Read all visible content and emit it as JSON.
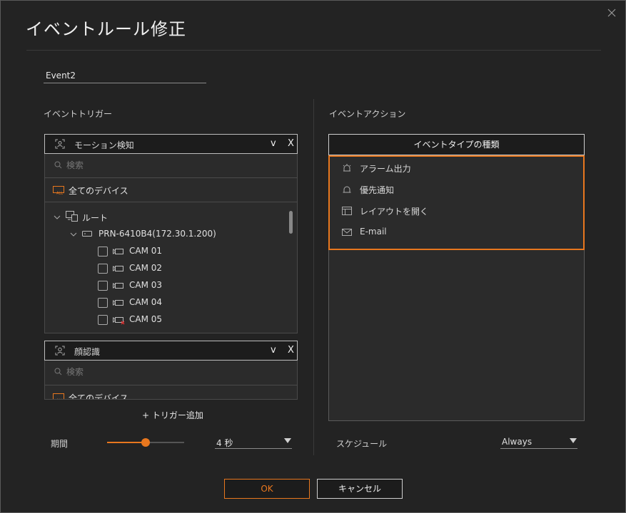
{
  "dialog": {
    "title": "イベントルール修正",
    "rule_name": "Event2"
  },
  "trigger": {
    "section_label": "イベントトリガー",
    "triggers": [
      {
        "type": "モーション検知",
        "dropdown": "v",
        "remove": "X",
        "search_placeholder": "検索",
        "all_devices": "全てのデバイス",
        "tree": {
          "root": "ルート",
          "device": "PRN-6410B4(172.30.1.200)",
          "cameras": [
            "CAM 01",
            "CAM 02",
            "CAM 03",
            "CAM 04",
            "CAM 05"
          ]
        }
      },
      {
        "type": "顔認識",
        "dropdown": "v",
        "remove": "X",
        "search_placeholder": "検索",
        "all_devices": "全てのデバイス"
      }
    ],
    "add_label": "+ トリガー追加",
    "duration": {
      "label": "期間",
      "slider_fraction": 0.5,
      "value": "4 秒"
    }
  },
  "action": {
    "section_label": "イベントアクション",
    "header": "イベントタイプの種類",
    "items": [
      {
        "label": "アラーム出力",
        "icon": "alarm-output-icon"
      },
      {
        "label": "優先通知",
        "icon": "priority-notification-icon"
      },
      {
        "label": "レイアウトを開く",
        "icon": "layout-icon"
      },
      {
        "label": "E-mail",
        "icon": "mail-icon"
      }
    ],
    "schedule": {
      "label": "スケジュール",
      "value": "Always"
    }
  },
  "buttons": {
    "ok": "OK",
    "cancel": "キャンセル"
  },
  "colors": {
    "accent": "#e8771e",
    "background": "#232323",
    "panel": "#2b2b2b"
  }
}
